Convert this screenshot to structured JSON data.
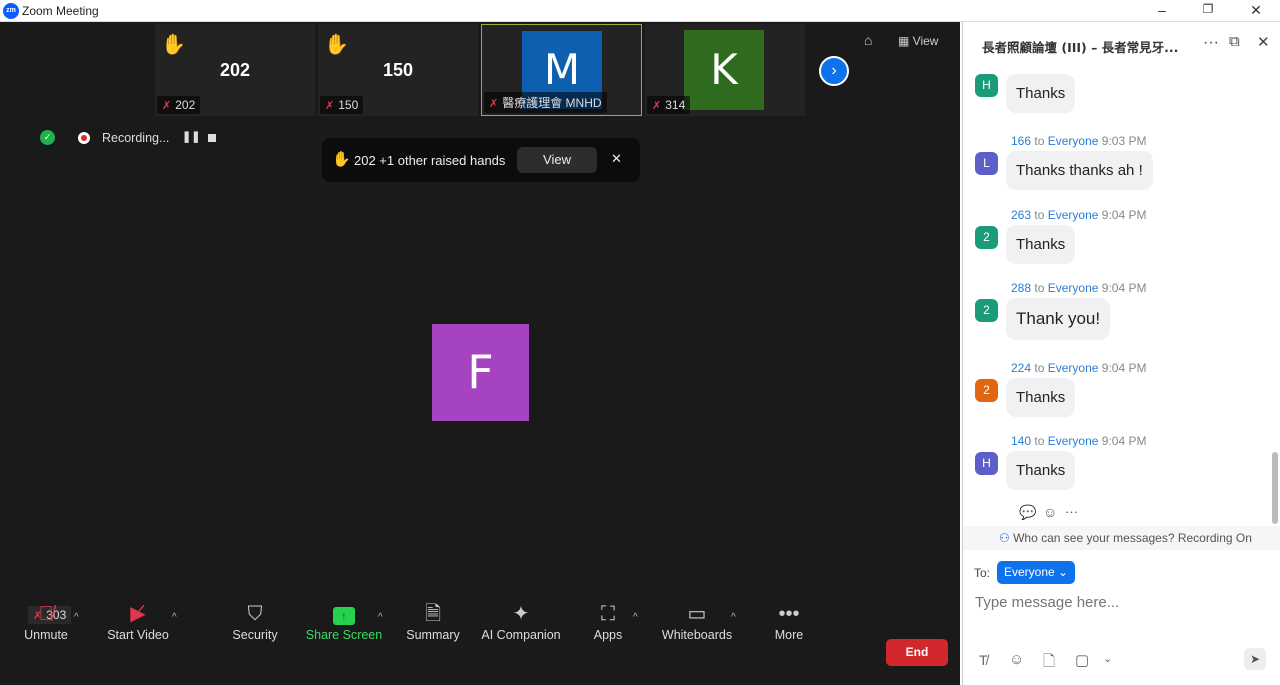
{
  "window": {
    "title": "Zoom Meeting",
    "logo": "zm"
  },
  "thumbnails": [
    {
      "display": "202",
      "label": "202",
      "hand": true
    },
    {
      "display": "150",
      "label": "150",
      "hand": true
    },
    {
      "display": "M",
      "label": "醫療護理會 MNHD",
      "color": "#0f5fb0",
      "active": true
    },
    {
      "display": "K",
      "label": "314",
      "color": "#2e6b1f"
    }
  ],
  "top_right": {
    "view_label": "View"
  },
  "recording": {
    "label": "Recording..."
  },
  "raised_banner": {
    "text": "202 +1 other raised hands",
    "view_label": "View"
  },
  "speaker": {
    "initial": "F",
    "color": "#a543c0"
  },
  "self_label": "303",
  "toolbar": {
    "items": [
      {
        "label": "Unmute",
        "icon": "mic-off-icon"
      },
      {
        "label": "Start Video",
        "icon": "video-off-icon"
      },
      {
        "label": "Security",
        "icon": "shield-icon"
      },
      {
        "label": "Share Screen",
        "icon": "share-screen-icon"
      },
      {
        "label": "Summary",
        "icon": "summary-icon"
      },
      {
        "label": "AI Companion",
        "icon": "sparkle-icon"
      },
      {
        "label": "Apps",
        "icon": "apps-icon"
      },
      {
        "label": "Whiteboards",
        "icon": "whiteboard-icon"
      },
      {
        "label": "More",
        "icon": "more-icon"
      }
    ],
    "end_label": "End"
  },
  "chat": {
    "title": "長者照顧論壇 (III) – 長者常見牙...",
    "messages": [
      {
        "initial": "H",
        "color": "#1a9c7a",
        "text": "Thanks"
      },
      {
        "sender": "166",
        "to": "to",
        "target": "Everyone",
        "time": "9:03 PM",
        "initial": "L",
        "color": "#5b5fc7",
        "text": "Thanks thanks ah !"
      },
      {
        "sender": "263",
        "to": "to",
        "target": "Everyone",
        "time": "9:04 PM",
        "initial": "2",
        "color": "#1a9c7a",
        "text": "Thanks"
      },
      {
        "sender": "288",
        "to": "to",
        "target": "Everyone",
        "time": "9:04 PM",
        "initial": "2",
        "color": "#1a9c7a",
        "text": "Thank you!"
      },
      {
        "sender": "224",
        "to": "to",
        "target": "Everyone",
        "time": "9:04 PM",
        "initial": "2",
        "color": "#e0660f",
        "text": "Thanks"
      },
      {
        "sender": "140",
        "to": "to",
        "target": "Everyone",
        "time": "9:04 PM",
        "initial": "H",
        "color": "#5b5fc7",
        "text": "Thanks"
      }
    ],
    "notice": "Who can see your messages? Recording On",
    "to_label": "To:",
    "to_value": "Everyone",
    "placeholder": "Type message here..."
  }
}
